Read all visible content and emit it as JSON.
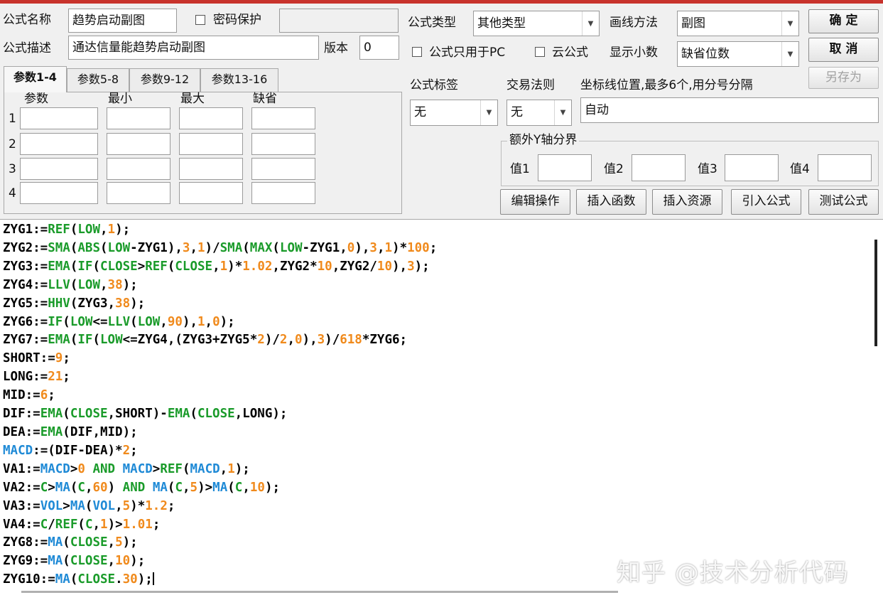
{
  "form": {
    "name_label": "公式名称",
    "name_value": "趋势启动副图",
    "password_label": "密码保护",
    "password_value": "",
    "desc_label": "公式描述",
    "desc_value": "通达信量能趋势启动副图",
    "version_label": "版本",
    "version_value": "0",
    "type_label": "公式类型",
    "type_value": "其他类型",
    "draw_label": "画线方法",
    "draw_value": "副图",
    "pc_only_label": "公式只用于PC",
    "cloud_label": "云公式",
    "decimals_label": "显示小数",
    "decimals_value": "缺省位数",
    "tag_label": "公式标签",
    "tag_value": "无",
    "rule_label": "交易法则",
    "rule_value": "无",
    "coord_label": "坐标线位置,最多6个,用分号分隔",
    "coord_value": "自动",
    "extra_y_label": "额外Y轴分界",
    "val_labels": [
      "值1",
      "值2",
      "值3",
      "值4"
    ]
  },
  "buttons": {
    "ok": "确  定",
    "cancel": "取  消",
    "save_as": "另存为",
    "edit_ops": "编辑操作",
    "insert_func": "插入函数",
    "insert_res": "插入资源",
    "import_formula": "引入公式",
    "test_formula": "测试公式"
  },
  "tabs": [
    "参数1-4",
    "参数5-8",
    "参数9-12",
    "参数13-16"
  ],
  "params": {
    "headers": [
      "参数",
      "最小",
      "最大",
      "缺省"
    ],
    "rows": [
      "1",
      "2",
      "3",
      "4"
    ]
  },
  "code_lines": [
    [
      [
        "ZYG1:=",
        ""
      ],
      [
        "REF",
        "fn"
      ],
      [
        "(",
        ""
      ],
      [
        "LOW",
        "fn"
      ],
      [
        ",",
        ""
      ],
      [
        "1",
        "num"
      ],
      [
        ");",
        ""
      ]
    ],
    [
      [
        "ZYG2:=",
        ""
      ],
      [
        "SMA",
        "fn"
      ],
      [
        "(",
        ""
      ],
      [
        "ABS",
        "fn"
      ],
      [
        "(",
        ""
      ],
      [
        "LOW",
        "fn"
      ],
      [
        "-ZYG1),",
        ""
      ],
      [
        "3",
        "num"
      ],
      [
        ",",
        ""
      ],
      [
        "1",
        "num"
      ],
      [
        ")/",
        ""
      ],
      [
        "SMA",
        "fn"
      ],
      [
        "(",
        ""
      ],
      [
        "MAX",
        "fn"
      ],
      [
        "(",
        ""
      ],
      [
        "LOW",
        "fn"
      ],
      [
        "-ZYG1,",
        ""
      ],
      [
        "0",
        "num"
      ],
      [
        "),",
        ""
      ],
      [
        "3",
        "num"
      ],
      [
        ",",
        ""
      ],
      [
        "1",
        "num"
      ],
      [
        ")*",
        ""
      ],
      [
        "100",
        "num"
      ],
      [
        ";",
        ""
      ]
    ],
    [
      [
        "ZYG3:=",
        ""
      ],
      [
        "EMA",
        "fn"
      ],
      [
        "(",
        ""
      ],
      [
        "IF",
        "fn"
      ],
      [
        "(",
        ""
      ],
      [
        "CLOSE",
        "fn"
      ],
      [
        ">",
        ""
      ],
      [
        "REF",
        "fn"
      ],
      [
        "(",
        ""
      ],
      [
        "CLOSE",
        "fn"
      ],
      [
        ",",
        ""
      ],
      [
        "1",
        "num"
      ],
      [
        ")*",
        ""
      ],
      [
        "1.02",
        "num"
      ],
      [
        ",ZYG2*",
        ""
      ],
      [
        "10",
        "num"
      ],
      [
        ",ZYG2/",
        ""
      ],
      [
        "10",
        "num"
      ],
      [
        "),",
        ""
      ],
      [
        "3",
        "num"
      ],
      [
        ");",
        ""
      ]
    ],
    [
      [
        "ZYG4:=",
        ""
      ],
      [
        "LLV",
        "fn"
      ],
      [
        "(",
        ""
      ],
      [
        "LOW",
        "fn"
      ],
      [
        ",",
        ""
      ],
      [
        "38",
        "num"
      ],
      [
        ");",
        ""
      ]
    ],
    [
      [
        "ZYG5:=",
        ""
      ],
      [
        "HHV",
        "fn"
      ],
      [
        "(ZYG3,",
        ""
      ],
      [
        "38",
        "num"
      ],
      [
        ");",
        ""
      ]
    ],
    [
      [
        "ZYG6:=",
        ""
      ],
      [
        "IF",
        "fn"
      ],
      [
        "(",
        ""
      ],
      [
        "LOW",
        "fn"
      ],
      [
        "<=",
        ""
      ],
      [
        "LLV",
        "fn"
      ],
      [
        "(",
        ""
      ],
      [
        "LOW",
        "fn"
      ],
      [
        ",",
        ""
      ],
      [
        "90",
        "num"
      ],
      [
        "),",
        ""
      ],
      [
        "1",
        "num"
      ],
      [
        ",",
        ""
      ],
      [
        "0",
        "num"
      ],
      [
        ");",
        ""
      ]
    ],
    [
      [
        "ZYG7:=",
        ""
      ],
      [
        "EMA",
        "fn"
      ],
      [
        "(",
        ""
      ],
      [
        "IF",
        "fn"
      ],
      [
        "(",
        ""
      ],
      [
        "LOW",
        "fn"
      ],
      [
        "<=ZYG4,(ZYG3+ZYG5*",
        ""
      ],
      [
        "2",
        "num"
      ],
      [
        ")/",
        ""
      ],
      [
        "2",
        "num"
      ],
      [
        ",",
        ""
      ],
      [
        "0",
        "num"
      ],
      [
        "),",
        ""
      ],
      [
        "3",
        "num"
      ],
      [
        ")/",
        ""
      ],
      [
        "618",
        "num"
      ],
      [
        "*ZYG6;",
        ""
      ]
    ],
    [
      [
        "SHORT:=",
        ""
      ],
      [
        "9",
        "num"
      ],
      [
        ";",
        ""
      ]
    ],
    [
      [
        "LONG:=",
        ""
      ],
      [
        "21",
        "num"
      ],
      [
        ";",
        ""
      ]
    ],
    [
      [
        "MID:=",
        ""
      ],
      [
        "6",
        "num"
      ],
      [
        ";",
        ""
      ]
    ],
    [
      [
        "DIF:=",
        ""
      ],
      [
        "EMA",
        "fn"
      ],
      [
        "(",
        ""
      ],
      [
        "CLOSE",
        "fn"
      ],
      [
        ",SHORT)-",
        ""
      ],
      [
        "EMA",
        "fn"
      ],
      [
        "(",
        ""
      ],
      [
        "CLOSE",
        "fn"
      ],
      [
        ",LONG);",
        ""
      ]
    ],
    [
      [
        "DEA:=",
        ""
      ],
      [
        "EMA",
        "fn"
      ],
      [
        "(DIF,MID);",
        ""
      ]
    ],
    [
      [
        "MACD",
        "kw"
      ],
      [
        ":=(DIF-DEA)*",
        ""
      ],
      [
        "2",
        "num"
      ],
      [
        ";",
        ""
      ]
    ],
    [
      [
        "VA1:=",
        ""
      ],
      [
        "MACD",
        "kw"
      ],
      [
        ">",
        ""
      ],
      [
        "0",
        "num"
      ],
      [
        " ",
        ""
      ],
      [
        "AND",
        "fn"
      ],
      [
        " ",
        ""
      ],
      [
        "MACD",
        "kw"
      ],
      [
        ">",
        ""
      ],
      [
        "REF",
        "fn"
      ],
      [
        "(",
        ""
      ],
      [
        "MACD",
        "kw"
      ],
      [
        ",",
        ""
      ],
      [
        "1",
        "num"
      ],
      [
        ");",
        ""
      ]
    ],
    [
      [
        "VA2:=",
        ""
      ],
      [
        "C",
        "fn"
      ],
      [
        ">",
        ""
      ],
      [
        "MA",
        "kw"
      ],
      [
        "(",
        ""
      ],
      [
        "C",
        "fn"
      ],
      [
        ",",
        ""
      ],
      [
        "60",
        "num"
      ],
      [
        ") ",
        ""
      ],
      [
        "AND",
        "fn"
      ],
      [
        " ",
        ""
      ],
      [
        "MA",
        "kw"
      ],
      [
        "(",
        ""
      ],
      [
        "C",
        "fn"
      ],
      [
        ",",
        ""
      ],
      [
        "5",
        "num"
      ],
      [
        ")>",
        ""
      ],
      [
        "MA",
        "kw"
      ],
      [
        "(",
        ""
      ],
      [
        "C",
        "fn"
      ],
      [
        ",",
        ""
      ],
      [
        "10",
        "num"
      ],
      [
        ");",
        ""
      ]
    ],
    [
      [
        "VA3:=",
        ""
      ],
      [
        "VOL",
        "kw"
      ],
      [
        ">",
        ""
      ],
      [
        "MA",
        "kw"
      ],
      [
        "(",
        ""
      ],
      [
        "VOL",
        "kw"
      ],
      [
        ",",
        ""
      ],
      [
        "5",
        "num"
      ],
      [
        ")*",
        ""
      ],
      [
        "1.2",
        "num"
      ],
      [
        ";",
        ""
      ]
    ],
    [
      [
        "VA4:=",
        ""
      ],
      [
        "C",
        "fn"
      ],
      [
        "/",
        ""
      ],
      [
        "REF",
        "fn"
      ],
      [
        "(",
        ""
      ],
      [
        "C",
        "fn"
      ],
      [
        ",",
        ""
      ],
      [
        "1",
        "num"
      ],
      [
        ")>",
        ""
      ],
      [
        "1.01",
        "num"
      ],
      [
        ";",
        ""
      ]
    ],
    [
      [
        "ZYG8:=",
        ""
      ],
      [
        "MA",
        "kw"
      ],
      [
        "(",
        ""
      ],
      [
        "CLOSE",
        "fn"
      ],
      [
        ",",
        ""
      ],
      [
        "5",
        "num"
      ],
      [
        ");",
        ""
      ]
    ],
    [
      [
        "ZYG9:=",
        ""
      ],
      [
        "MA",
        "kw"
      ],
      [
        "(",
        ""
      ],
      [
        "CLOSE",
        "fn"
      ],
      [
        ",",
        ""
      ],
      [
        "10",
        "num"
      ],
      [
        ");",
        ""
      ]
    ],
    [
      [
        "ZYG10:=",
        ""
      ],
      [
        "MA",
        "kw"
      ],
      [
        "(",
        ""
      ],
      [
        "CLOSE",
        "fn"
      ],
      [
        ".",
        ""
      ],
      [
        "30",
        "num"
      ],
      [
        ");",
        ""
      ]
    ]
  ],
  "watermark": "知乎 @技术分析代码"
}
